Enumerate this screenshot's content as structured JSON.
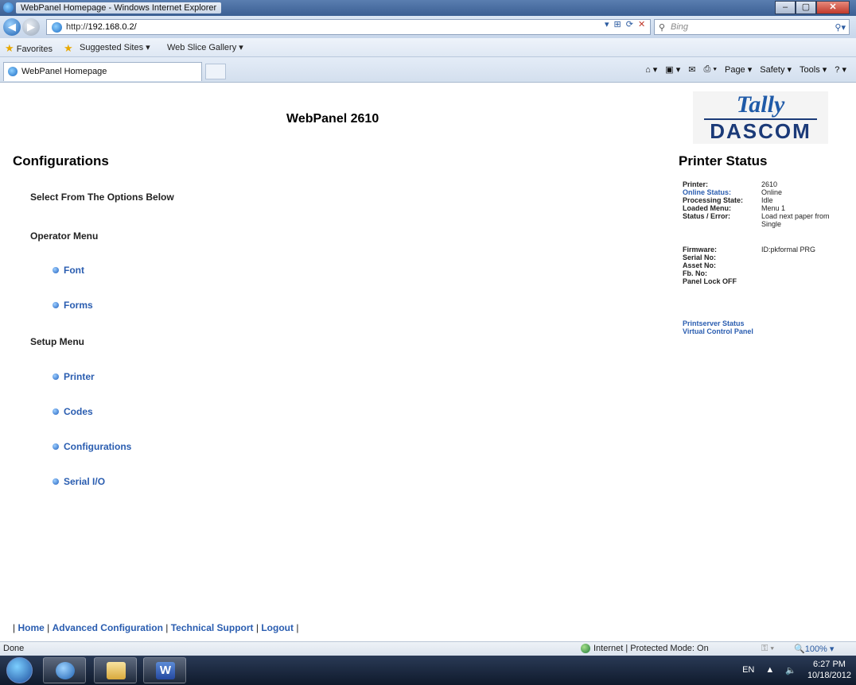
{
  "window": {
    "title": "WebPanel Homepage - Windows Internet Explorer",
    "minimize": "–",
    "maximize": "▢",
    "close": "✕"
  },
  "address_bar": {
    "prefix": "http://",
    "host": "192.168.0.2/",
    "search_placeholder": "Bing"
  },
  "favorites_bar": {
    "favorites_label": "Favorites",
    "items": [
      "Suggested Sites ▾",
      "Web Slice Gallery ▾"
    ]
  },
  "tab": {
    "label": "WebPanel Homepage"
  },
  "command_bar": {
    "page": "Page ▾",
    "safety": "Safety ▾",
    "tools": "Tools ▾"
  },
  "page": {
    "panel_title": "WebPanel 2610",
    "logo_top": "Tally",
    "logo_bottom": "DASCOM",
    "config_heading": "Configurations",
    "select_text": "Select From The Options Below",
    "operator_menu": {
      "heading": "Operator Menu",
      "items": [
        "Font",
        "Forms"
      ]
    },
    "setup_menu": {
      "heading": "Setup Menu",
      "items": [
        "Printer",
        "Codes",
        "Configurations",
        "Serial I/O"
      ]
    },
    "status": {
      "heading": "Printer Status",
      "rows": [
        {
          "label": "Printer:",
          "value": "2610"
        },
        {
          "label": "Online Status:",
          "value": "Online"
        },
        {
          "label": "Processing State:",
          "value": "Idle"
        },
        {
          "label": "Loaded Menu:",
          "value": "Menu 1"
        },
        {
          "label": "Status / Error:",
          "value": "Load next paper from Single"
        }
      ],
      "rows2": [
        {
          "label": "Firmware:",
          "value": "ID:pkformal PRG"
        },
        {
          "label": "Serial No:",
          "value": ""
        },
        {
          "label": "Asset No:",
          "value": ""
        },
        {
          "label": "Fb. No:",
          "value": ""
        },
        {
          "label": "Panel Lock OFF",
          "value": ""
        }
      ],
      "links": [
        "Printserver Status",
        "Virtual Control Panel"
      ]
    },
    "footer_links": [
      "Home",
      "Advanced Configuration",
      "Technical Support",
      "Logout"
    ]
  },
  "status_bar": {
    "left": "Done",
    "zone": "Internet | Protected Mode: On",
    "zoom": "100%"
  },
  "taskbar": {
    "language": "EN",
    "time": "6:27 PM",
    "date": "10/18/2012",
    "word_letter": "W"
  }
}
